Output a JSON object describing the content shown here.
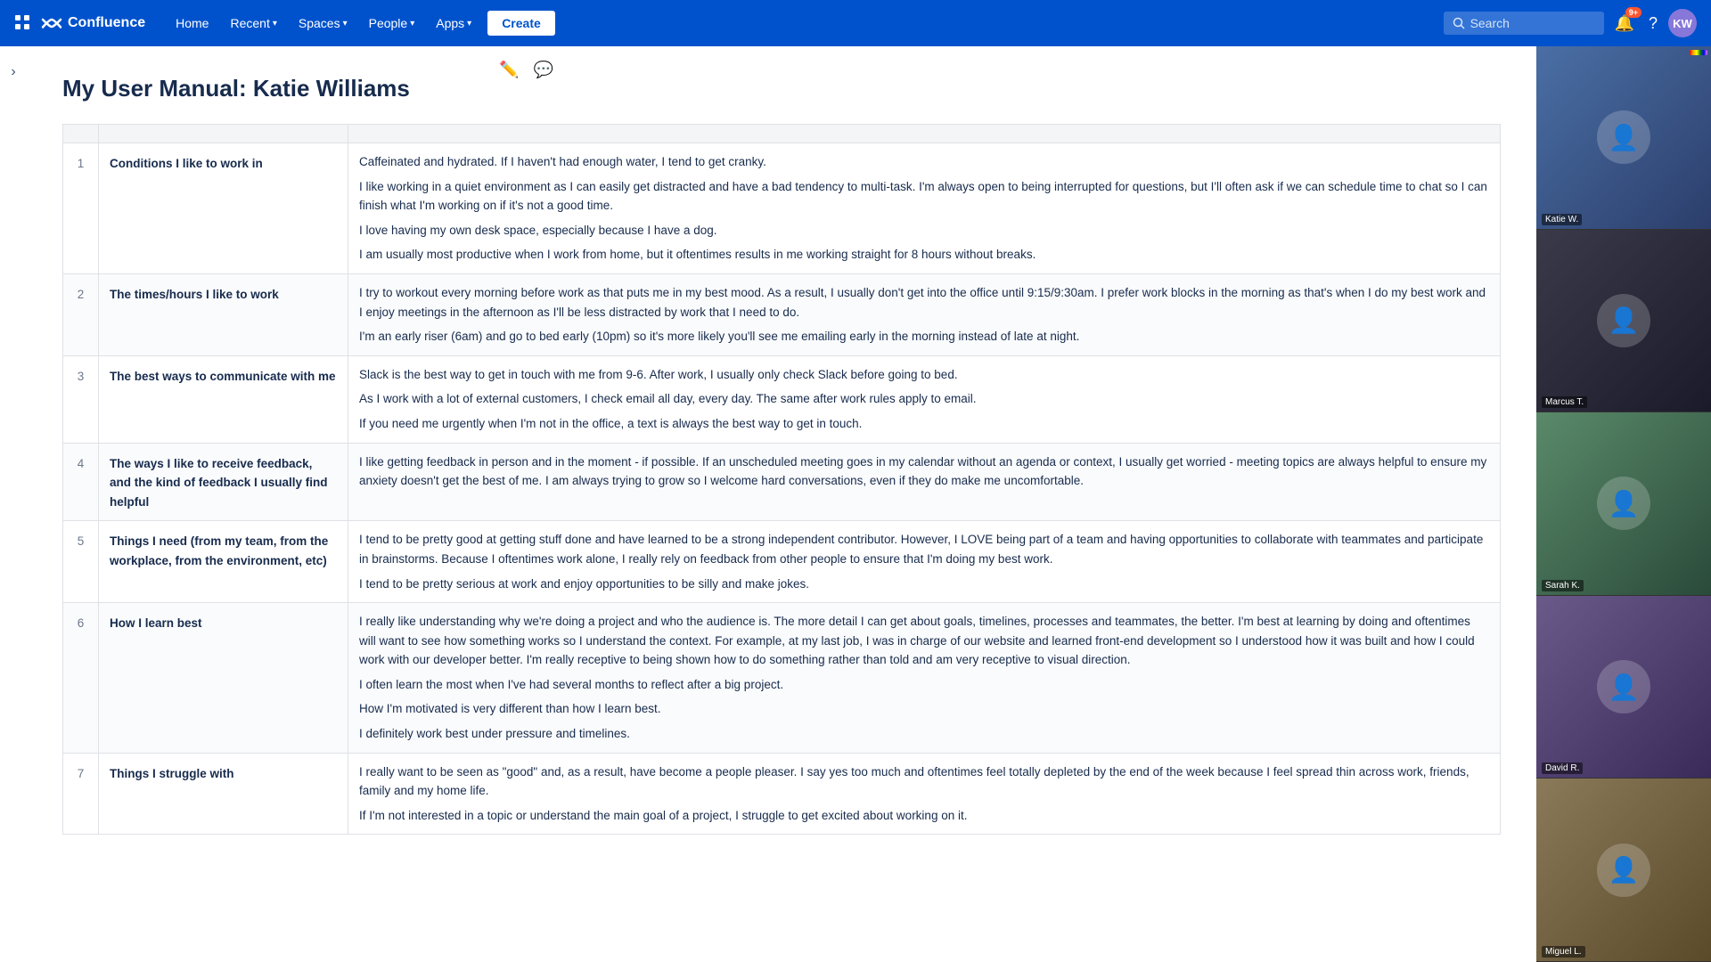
{
  "nav": {
    "logo_text": "Confluence",
    "home_label": "Home",
    "recent_label": "Recent",
    "spaces_label": "Spaces",
    "people_label": "People",
    "apps_label": "Apps",
    "create_label": "Create",
    "search_placeholder": "Search",
    "notif_count": "9+",
    "help_label": "Help"
  },
  "page": {
    "title": "My User Manual: Katie Williams",
    "sidebar_toggle": "›"
  },
  "table": {
    "rows": [
      {
        "num": "1",
        "label": "Conditions I like to work in",
        "content": [
          "Caffeinated and hydrated. If I haven't had enough water, I tend to get cranky.",
          "I like working in a quiet environment as I can easily get distracted and have a bad tendency to multi-task. I'm always open to being interrupted for questions, but I'll often ask if we can schedule time to chat so I can finish what I'm working on if it's not a good time.",
          "I love having my own desk space, especially because I have a dog.",
          "I am usually most productive when I work from home, but it oftentimes results in me working straight for 8 hours without breaks."
        ]
      },
      {
        "num": "2",
        "label": "The times/hours I like to work",
        "content": [
          "I try to workout every morning before work as that puts me in my best mood. As a result, I usually don't get into the office until 9:15/9:30am. I prefer work blocks in the morning as that's when I do my best work and I enjoy meetings in the afternoon as I'll be less distracted by work that I need to do.",
          "I'm an early riser (6am) and go to bed early (10pm) so it's more likely you'll see me emailing early in the morning instead of late at night."
        ]
      },
      {
        "num": "3",
        "label": "The best ways to communicate with me",
        "content": [
          "Slack is the best way to get in touch with me from 9-6. After work, I usually only check Slack before going to bed.",
          "As I work with a lot of external customers, I check email all day, every day. The same after work rules apply to email.",
          "If you need me urgently when I'm not in the office, a text is always the best way to get in touch."
        ]
      },
      {
        "num": "4",
        "label": "The ways I like to receive feedback, and the kind of feedback I usually find helpful",
        "content": [
          "I like getting feedback in person and in the moment - if possible. If an unscheduled meeting goes in my calendar without an agenda or context, I usually get worried - meeting topics are always helpful to ensure my anxiety doesn't get the best of me. I am always trying to grow so I welcome hard conversations, even if they do make me uncomfortable."
        ]
      },
      {
        "num": "5",
        "label": "Things I need (from my team, from the workplace, from the environment, etc)",
        "content": [
          "I tend to be pretty good at getting stuff done and have learned to be a strong independent contributor. However, I LOVE being part of a team and having opportunities to collaborate with teammates and participate in brainstorms. Because I oftentimes work alone, I really rely on feedback from other people to ensure that I'm doing my best work.",
          "I tend to be pretty serious at work and enjoy opportunities to be silly and make jokes."
        ]
      },
      {
        "num": "6",
        "label": "How I learn best",
        "content": [
          "I really like understanding why we're doing a project and who the audience is. The more detail I can get about goals, timelines, processes and teammates, the better. I'm best at learning by doing and oftentimes will want to see how something works so I understand the context. For example, at my last job, I was in charge of our website and learned front-end development so I understood how it was built and how I could work with our developer better. I'm really receptive to being shown how to do something rather than told and am very receptive to visual direction.",
          "I often learn the most when I've had several months to reflect after a big project.",
          "How I'm motivated is very different than how I learn best.",
          "I definitely work best under pressure and timelines."
        ]
      },
      {
        "num": "7",
        "label": "Things I struggle with",
        "content": [
          "I really want to be seen as \"good\" and, as a result, have become a people pleaser. I say yes too much and oftentimes feel totally depleted by the end of the week because I feel spread thin across work, friends, family and my home life.",
          "If I'm not interested in a topic or understand the main goal of a project, I struggle to get excited about working on it."
        ]
      }
    ]
  },
  "video_panel": {
    "participants": [
      {
        "name": "Katie W.",
        "bg": "video-bg-1",
        "has_rainbow": true
      },
      {
        "name": "Marcus T.",
        "bg": "video-bg-2",
        "has_rainbow": false
      },
      {
        "name": "Sarah K.",
        "bg": "video-bg-3",
        "has_rainbow": false
      },
      {
        "name": "David R.",
        "bg": "video-bg-4",
        "has_rainbow": false
      },
      {
        "name": "Miguel L.",
        "bg": "video-bg-5",
        "has_rainbow": false
      }
    ]
  }
}
